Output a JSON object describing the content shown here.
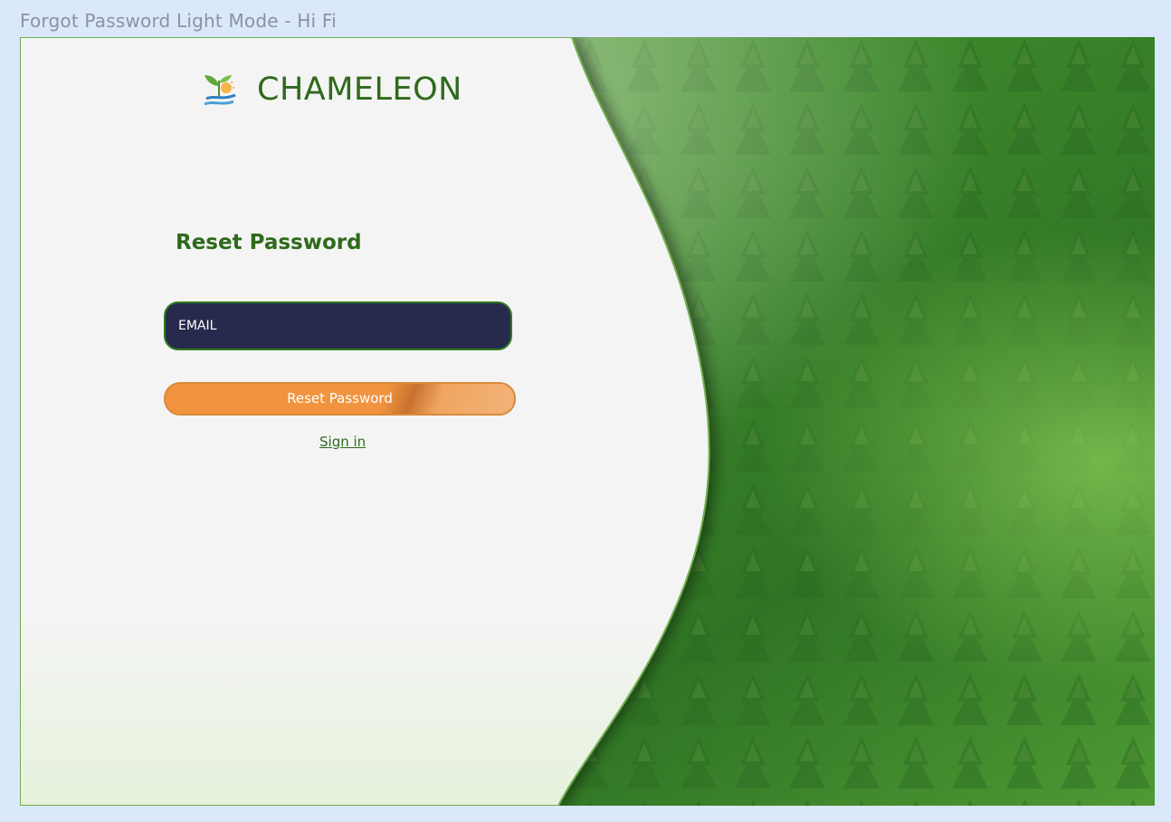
{
  "frame": {
    "title": "Forgot Password Light Mode - Hi Fi"
  },
  "brand": {
    "name": "CHAMELEON",
    "logo_icon": "sprout-sun-water-logo"
  },
  "form": {
    "heading": "Reset Password",
    "email_placeholder": "EMAIL",
    "email_value": "",
    "submit_label": "Reset Password",
    "signin_label": "Sign in"
  },
  "colors": {
    "brand_green": "#2f6a1c",
    "field_bg": "#272a4d",
    "field_border": "#2e7a22",
    "button_orange": "#f0943f",
    "page_bg": "#f4f4f4",
    "frame_bg": "#dbe8fb"
  }
}
